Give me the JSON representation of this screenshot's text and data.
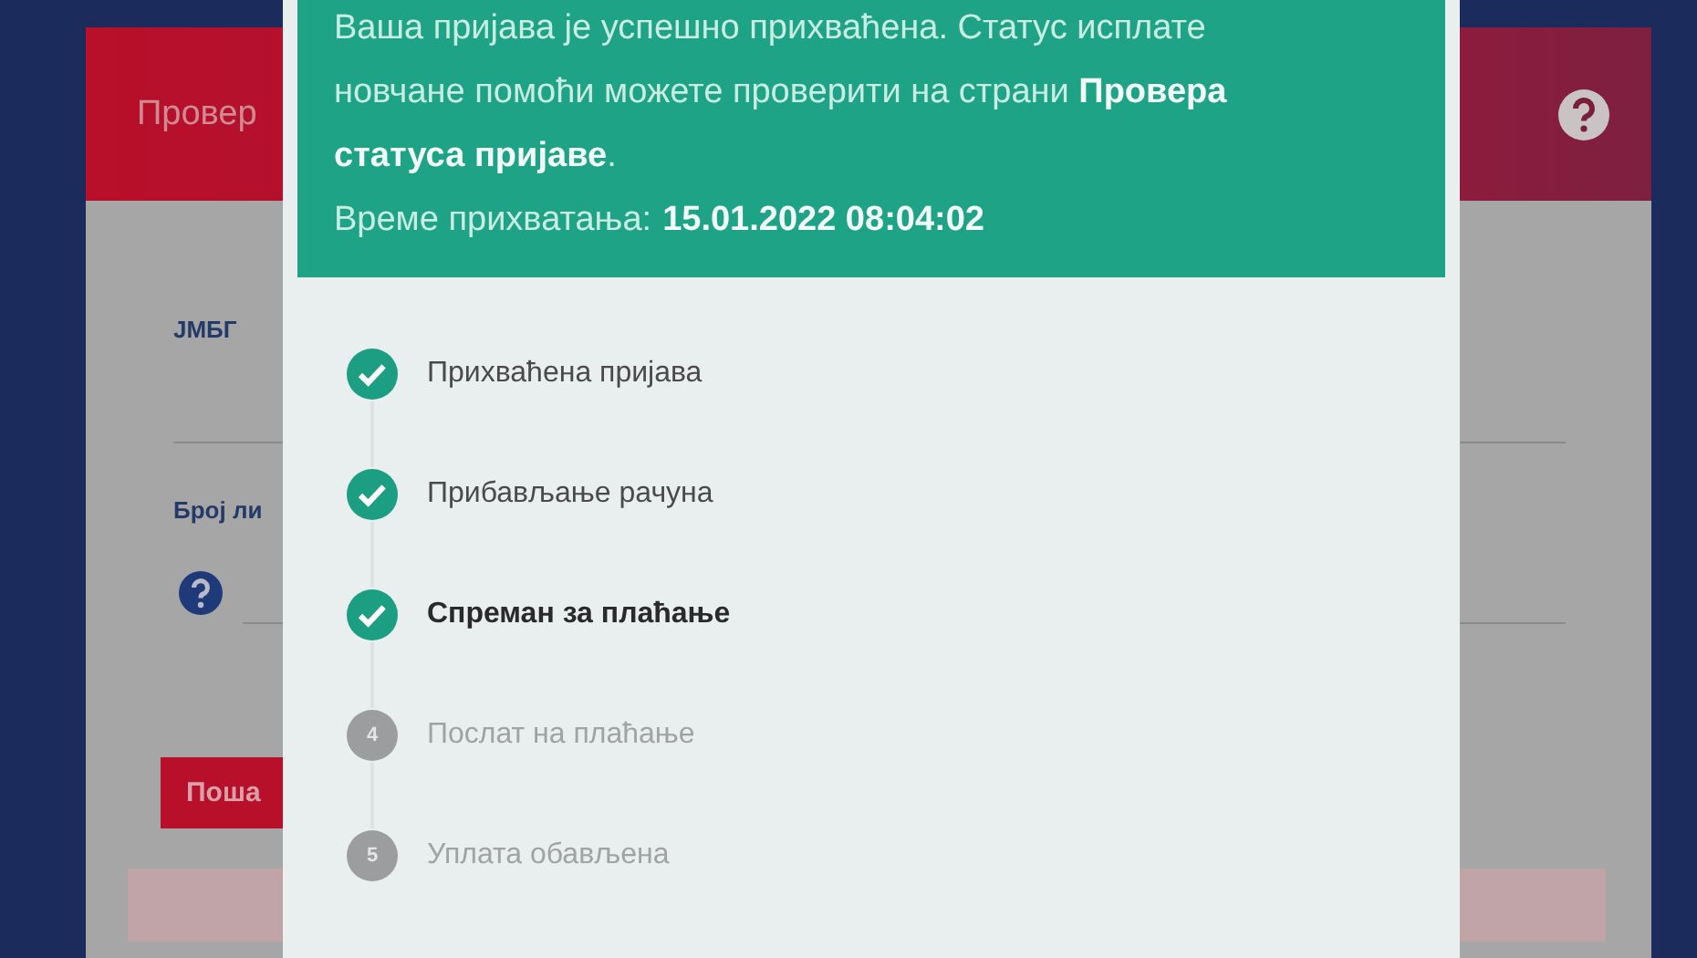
{
  "page": {
    "header_title": "Провер",
    "fields": [
      {
        "label": "ЈМБГ",
        "help": false
      },
      {
        "label": "Број ли",
        "help": true
      }
    ],
    "submit_button": "Поша"
  },
  "modal": {
    "banner": {
      "message": "Ваша пријава је успешно прихваћена. Статус исплате новчане помоћи можете проверити на страни **Провера статуса пријаве**.",
      "time_label": "Време прихватања:",
      "time_value": "15.01.2022 08:04:02"
    },
    "steps": [
      {
        "label": "Прихваћена пријава",
        "done": true,
        "current": false
      },
      {
        "label": "Прибављање рачуна",
        "done": true,
        "current": false
      },
      {
        "label": "Спреман за плаћање",
        "done": true,
        "current": true
      },
      {
        "label": "Послат на плаћање",
        "done": false,
        "current": false,
        "number": "4"
      },
      {
        "label": "Уплата обављена",
        "done": false,
        "current": false,
        "number": "5"
      }
    ]
  }
}
